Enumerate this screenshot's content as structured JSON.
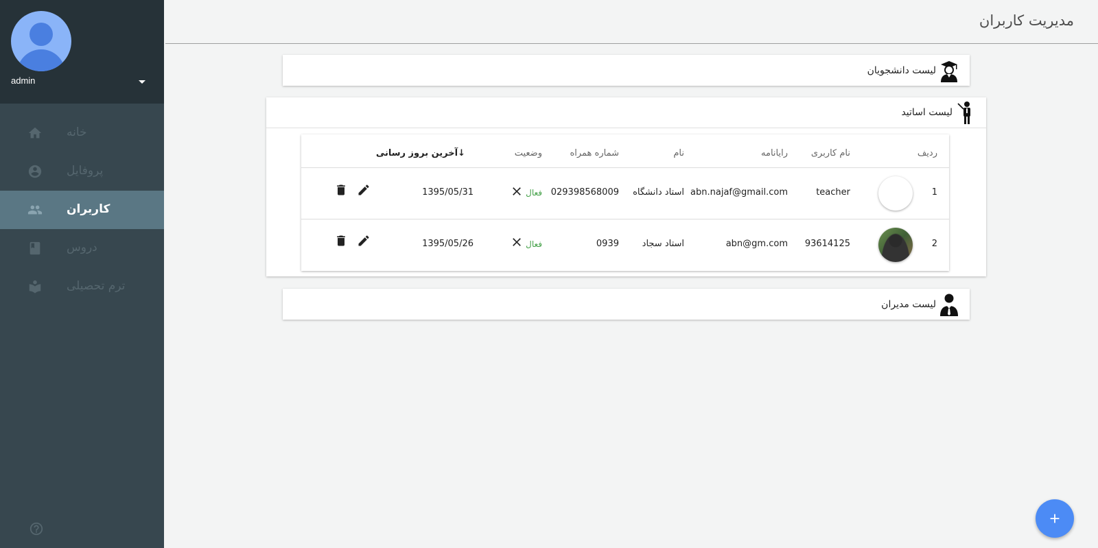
{
  "sidebar": {
    "username": "admin",
    "items": [
      {
        "label": "خانه",
        "icon": "home-icon"
      },
      {
        "label": "پروفایل",
        "icon": "account-circle-icon"
      },
      {
        "label": "کاربران",
        "icon": "group-icon",
        "active": true
      },
      {
        "label": "دروس",
        "icon": "book-icon"
      },
      {
        "label": "ترم تحصیلی",
        "icon": "school-icon"
      }
    ]
  },
  "header": {
    "title": "مدیریت کاربران"
  },
  "panels": {
    "students": {
      "title": "لیست دانشجویان",
      "icon": "graduate-icon"
    },
    "teachers": {
      "title": "لیست اساتید",
      "icon": "teacher-icon"
    },
    "managers": {
      "title": "لیست مدیران",
      "icon": "manager-icon"
    }
  },
  "table": {
    "columns": {
      "row": "ردیف",
      "username": "نام کاربری",
      "email": "رایانامه",
      "name": "نام",
      "phone": "شماره همراه",
      "status": "وضعیت",
      "updated": "آخرین بروز رسانی",
      "sort_arrow": "↓"
    },
    "rows": [
      {
        "index": "1",
        "username": "teacher",
        "email": "abn.najaf@gmail.com",
        "name": "استاد دانشگاه",
        "phone": "029398568009",
        "status": "فعال",
        "updated": "1395/05/31"
      },
      {
        "index": "2",
        "username": "93614125",
        "email": "abn@gm.com",
        "name": "استاد سجاد",
        "phone": "0939",
        "status": "فعال",
        "updated": "1395/05/26"
      }
    ]
  },
  "colors": {
    "sidebar": "#37474f",
    "sidebar_head": "#263238",
    "active_item": "#5a7784",
    "status_active": "#43a047",
    "fab": "#4c8bf5"
  }
}
